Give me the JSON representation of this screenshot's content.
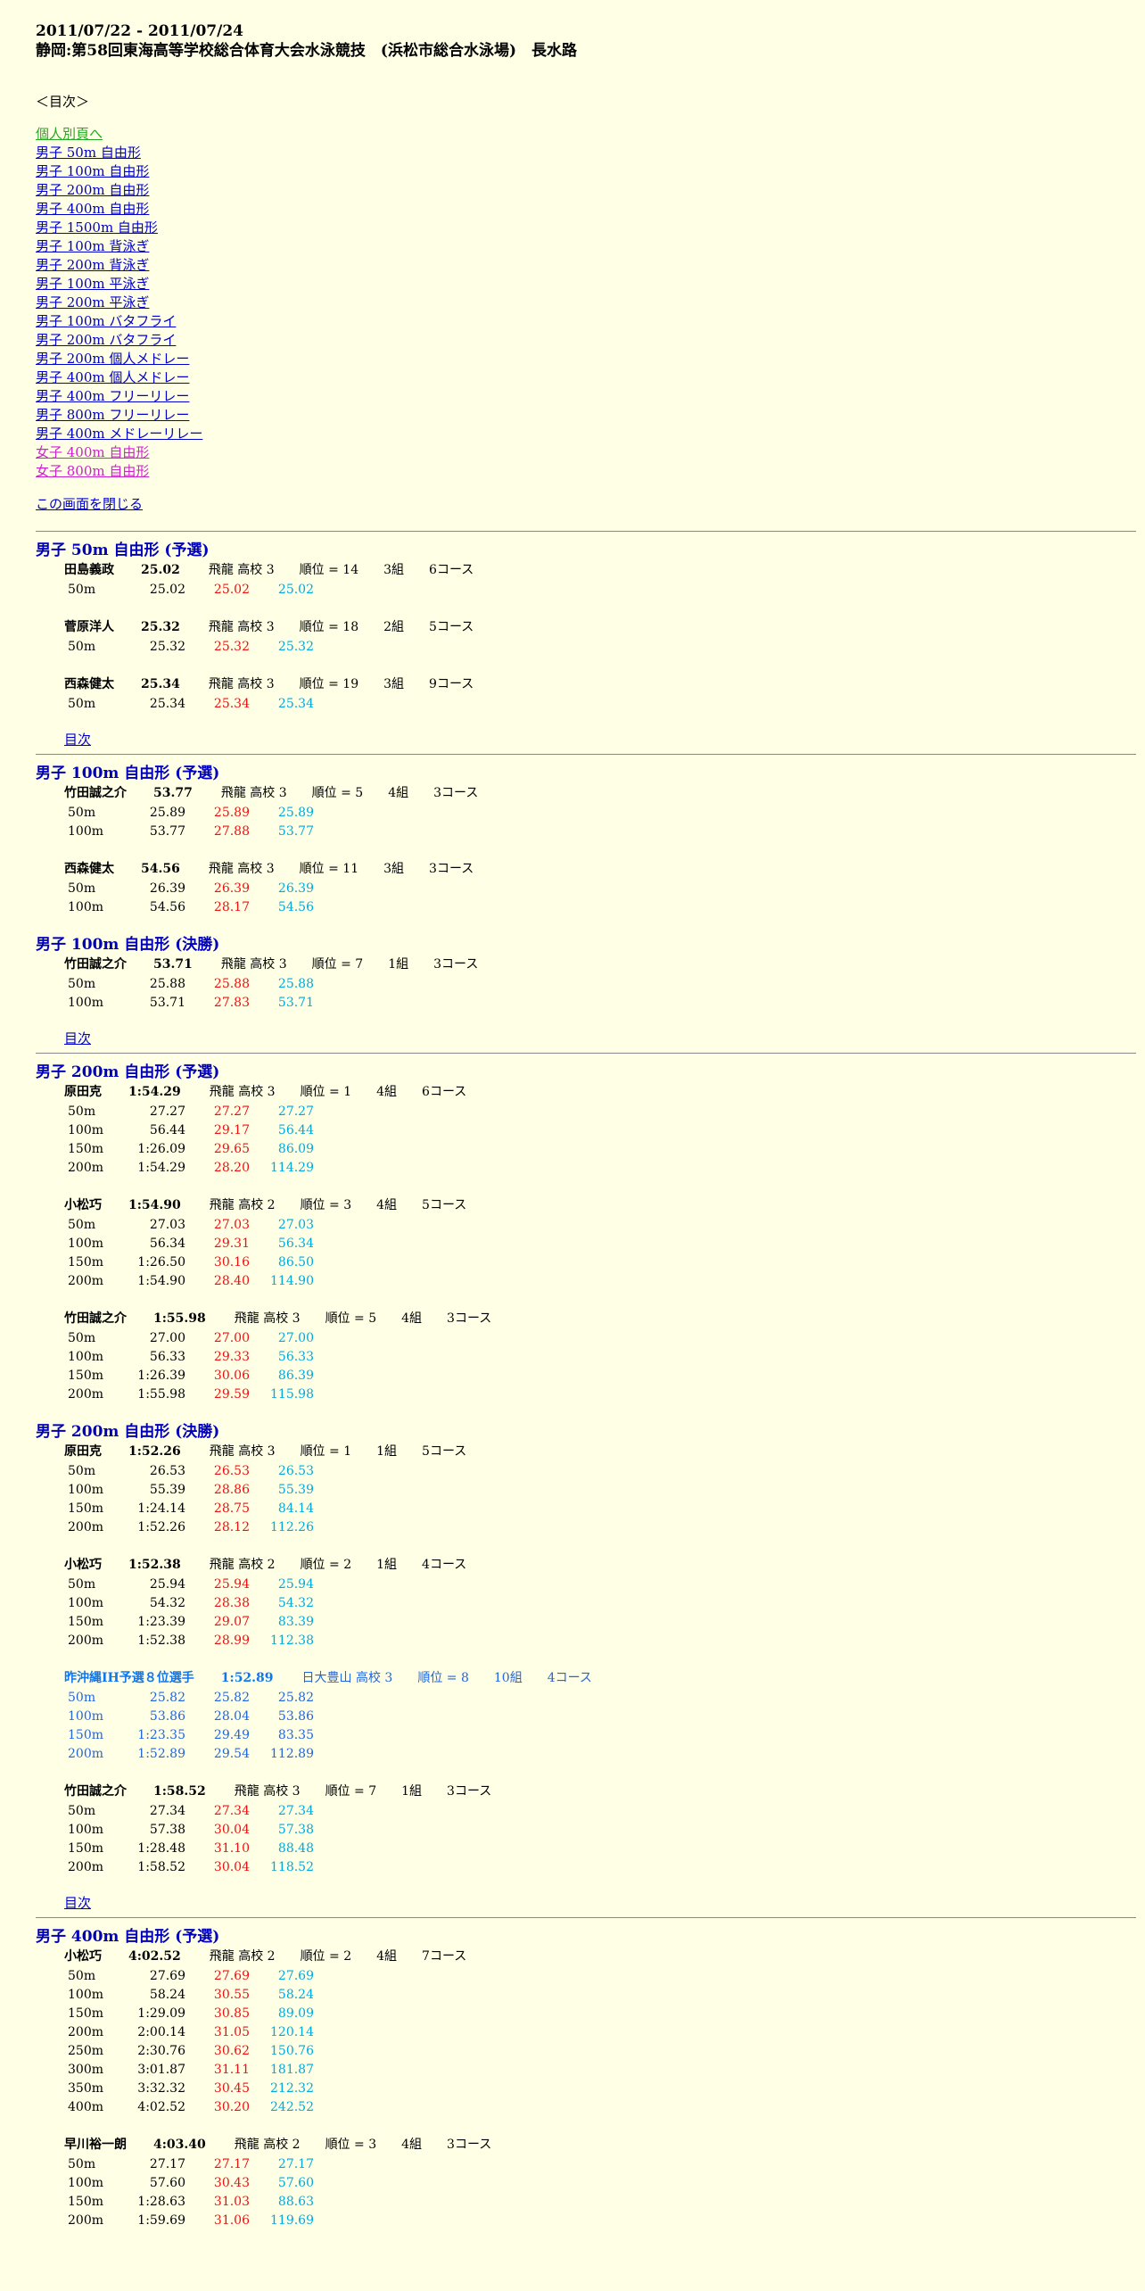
{
  "header": {
    "dates": "2011/07/22 - 2011/07/24",
    "meet": "静岡:第58回東海高等学校総合体育大会水泳競技　(浜松市総合水泳場)　長水路"
  },
  "toc": {
    "title": "＜目次＞",
    "links": [
      {
        "label": "個人別頁へ",
        "style": "green"
      },
      {
        "label": "男子 50m 自由形",
        "style": "blue"
      },
      {
        "label": "男子 100m 自由形",
        "style": "blue"
      },
      {
        "label": "男子 200m 自由形",
        "style": "blue"
      },
      {
        "label": "男子 400m 自由形",
        "style": "blue"
      },
      {
        "label": "男子 1500m 自由形",
        "style": "blue"
      },
      {
        "label": "男子 100m 背泳ぎ",
        "style": "blue"
      },
      {
        "label": "男子 200m 背泳ぎ",
        "style": "blue"
      },
      {
        "label": "男子 100m 平泳ぎ",
        "style": "blue"
      },
      {
        "label": "男子 200m 平泳ぎ",
        "style": "blue"
      },
      {
        "label": "男子 100m バタフライ",
        "style": "blue"
      },
      {
        "label": "男子 200m バタフライ",
        "style": "blue"
      },
      {
        "label": "男子 200m 個人メドレー",
        "style": "blue"
      },
      {
        "label": "男子 400m 個人メドレー",
        "style": "blue"
      },
      {
        "label": "男子 400m フリーリレー",
        "style": "blue"
      },
      {
        "label": "男子 800m フリーリレー",
        "style": "blue"
      },
      {
        "label": "男子 400m メドレーリレー",
        "style": "blue"
      },
      {
        "label": "女子 400m 自由形",
        "style": "magenta"
      },
      {
        "label": "女子 800m 自由形",
        "style": "magenta"
      }
    ],
    "close": "この画面を閉じる"
  },
  "mokuji_label": "目次",
  "sections": [
    {
      "events": [
        {
          "title": "男子 50m 自由形 (予選)",
          "swimmers": [
            {
              "name": "田島義政",
              "time": "25.02",
              "school": "飛龍 高校 3",
              "rank": "順位 = 14",
              "heat": "3組",
              "lane": "6コース",
              "splits": [
                [
                  "50m",
                  "25.02",
                  "25.02",
                  "25.02"
                ]
              ]
            },
            {
              "name": "菅原洋人",
              "time": "25.32",
              "school": "飛龍 高校 3",
              "rank": "順位 = 18",
              "heat": "2組",
              "lane": "5コース",
              "splits": [
                [
                  "50m",
                  "25.32",
                  "25.32",
                  "25.32"
                ]
              ]
            },
            {
              "name": "西森健太",
              "time": "25.34",
              "school": "飛龍 高校 3",
              "rank": "順位 = 19",
              "heat": "3組",
              "lane": "9コース",
              "splits": [
                [
                  "50m",
                  "25.34",
                  "25.34",
                  "25.34"
                ]
              ]
            }
          ]
        }
      ]
    },
    {
      "events": [
        {
          "title": "男子 100m 自由形 (予選)",
          "swimmers": [
            {
              "name": "竹田誠之介",
              "time": "53.77",
              "school": "飛龍 高校 3",
              "rank": "順位 = 5",
              "heat": "4組",
              "lane": "3コース",
              "splits": [
                [
                  "50m",
                  "25.89",
                  "25.89",
                  "25.89"
                ],
                [
                  "100m",
                  "53.77",
                  "27.88",
                  "53.77"
                ]
              ]
            },
            {
              "name": "西森健太",
              "time": "54.56",
              "school": "飛龍 高校 3",
              "rank": "順位 = 11",
              "heat": "3組",
              "lane": "3コース",
              "splits": [
                [
                  "50m",
                  "26.39",
                  "26.39",
                  "26.39"
                ],
                [
                  "100m",
                  "54.56",
                  "28.17",
                  "54.56"
                ]
              ]
            }
          ]
        },
        {
          "title": "男子 100m 自由形 (決勝)",
          "swimmers": [
            {
              "name": "竹田誠之介",
              "time": "53.71",
              "school": "飛龍 高校 3",
              "rank": "順位 = 7",
              "heat": "1組",
              "lane": "3コース",
              "splits": [
                [
                  "50m",
                  "25.88",
                  "25.88",
                  "25.88"
                ],
                [
                  "100m",
                  "53.71",
                  "27.83",
                  "53.71"
                ]
              ]
            }
          ]
        }
      ]
    },
    {
      "events": [
        {
          "title": "男子 200m 自由形 (予選)",
          "swimmers": [
            {
              "name": "原田克",
              "time": "1:54.29",
              "school": "飛龍 高校 3",
              "rank": "順位 = 1",
              "heat": "4組",
              "lane": "6コース",
              "splits": [
                [
                  "50m",
                  "27.27",
                  "27.27",
                  "27.27"
                ],
                [
                  "100m",
                  "56.44",
                  "29.17",
                  "56.44"
                ],
                [
                  "150m",
                  "1:26.09",
                  "29.65",
                  "86.09"
                ],
                [
                  "200m",
                  "1:54.29",
                  "28.20",
                  "114.29"
                ]
              ]
            },
            {
              "name": "小松巧",
              "time": "1:54.90",
              "school": "飛龍 高校 2",
              "rank": "順位 = 3",
              "heat": "4組",
              "lane": "5コース",
              "splits": [
                [
                  "50m",
                  "27.03",
                  "27.03",
                  "27.03"
                ],
                [
                  "100m",
                  "56.34",
                  "29.31",
                  "56.34"
                ],
                [
                  "150m",
                  "1:26.50",
                  "30.16",
                  "86.50"
                ],
                [
                  "200m",
                  "1:54.90",
                  "28.40",
                  "114.90"
                ]
              ]
            },
            {
              "name": "竹田誠之介",
              "time": "1:55.98",
              "school": "飛龍 高校 3",
              "rank": "順位 = 5",
              "heat": "4組",
              "lane": "3コース",
              "splits": [
                [
                  "50m",
                  "27.00",
                  "27.00",
                  "27.00"
                ],
                [
                  "100m",
                  "56.33",
                  "29.33",
                  "56.33"
                ],
                [
                  "150m",
                  "1:26.39",
                  "30.06",
                  "86.39"
                ],
                [
                  "200m",
                  "1:55.98",
                  "29.59",
                  "115.98"
                ]
              ]
            }
          ]
        },
        {
          "title": "男子 200m 自由形 (決勝)",
          "swimmers": [
            {
              "name": "原田克",
              "time": "1:52.26",
              "school": "飛龍 高校 3",
              "rank": "順位 = 1",
              "heat": "1組",
              "lane": "5コース",
              "splits": [
                [
                  "50m",
                  "26.53",
                  "26.53",
                  "26.53"
                ],
                [
                  "100m",
                  "55.39",
                  "28.86",
                  "55.39"
                ],
                [
                  "150m",
                  "1:24.14",
                  "28.75",
                  "84.14"
                ],
                [
                  "200m",
                  "1:52.26",
                  "28.12",
                  "112.26"
                ]
              ]
            },
            {
              "name": "小松巧",
              "time": "1:52.38",
              "school": "飛龍 高校 2",
              "rank": "順位 = 2",
              "heat": "1組",
              "lane": "4コース",
              "splits": [
                [
                  "50m",
                  "25.94",
                  "25.94",
                  "25.94"
                ],
                [
                  "100m",
                  "54.32",
                  "28.38",
                  "54.32"
                ],
                [
                  "150m",
                  "1:23.39",
                  "29.07",
                  "83.39"
                ],
                [
                  "200m",
                  "1:52.38",
                  "28.99",
                  "112.38"
                ]
              ]
            },
            {
              "name": "昨沖縄IH予選８位選手",
              "time": "1:52.89",
              "school": "日大豊山 高校 3",
              "rank": "順位 = 8",
              "heat": "10組",
              "lane": "4コース",
              "ref": true,
              "splits": [
                [
                  "50m",
                  "25.82",
                  "25.82",
                  "25.82"
                ],
                [
                  "100m",
                  "53.86",
                  "28.04",
                  "53.86"
                ],
                [
                  "150m",
                  "1:23.35",
                  "29.49",
                  "83.35"
                ],
                [
                  "200m",
                  "1:52.89",
                  "29.54",
                  "112.89"
                ]
              ]
            },
            {
              "name": "竹田誠之介",
              "time": "1:58.52",
              "school": "飛龍 高校 3",
              "rank": "順位 = 7",
              "heat": "1組",
              "lane": "3コース",
              "splits": [
                [
                  "50m",
                  "27.34",
                  "27.34",
                  "27.34"
                ],
                [
                  "100m",
                  "57.38",
                  "30.04",
                  "57.38"
                ],
                [
                  "150m",
                  "1:28.48",
                  "31.10",
                  "88.48"
                ],
                [
                  "200m",
                  "1:58.52",
                  "30.04",
                  "118.52"
                ]
              ]
            }
          ]
        }
      ]
    },
    {
      "events": [
        {
          "title": "男子 400m 自由形 (予選)",
          "swimmers": [
            {
              "name": "小松巧",
              "time": "4:02.52",
              "school": "飛龍 高校 2",
              "rank": "順位 = 2",
              "heat": "4組",
              "lane": "7コース",
              "splits": [
                [
                  "50m",
                  "27.69",
                  "27.69",
                  "27.69"
                ],
                [
                  "100m",
                  "58.24",
                  "30.55",
                  "58.24"
                ],
                [
                  "150m",
                  "1:29.09",
                  "30.85",
                  "89.09"
                ],
                [
                  "200m",
                  "2:00.14",
                  "31.05",
                  "120.14"
                ],
                [
                  "250m",
                  "2:30.76",
                  "30.62",
                  "150.76"
                ],
                [
                  "300m",
                  "3:01.87",
                  "31.11",
                  "181.87"
                ],
                [
                  "350m",
                  "3:32.32",
                  "30.45",
                  "212.32"
                ],
                [
                  "400m",
                  "4:02.52",
                  "30.20",
                  "242.52"
                ]
              ]
            },
            {
              "name": "早川裕一朗",
              "time": "4:03.40",
              "school": "飛龍 高校 2",
              "rank": "順位 = 3",
              "heat": "4組",
              "lane": "3コース",
              "splits": [
                [
                  "50m",
                  "27.17",
                  "27.17",
                  "27.17"
                ],
                [
                  "100m",
                  "57.60",
                  "30.43",
                  "57.60"
                ],
                [
                  "150m",
                  "1:28.63",
                  "31.03",
                  "88.63"
                ],
                [
                  "200m",
                  "1:59.69",
                  "31.06",
                  "119.69"
                ]
              ]
            }
          ]
        }
      ]
    }
  ]
}
